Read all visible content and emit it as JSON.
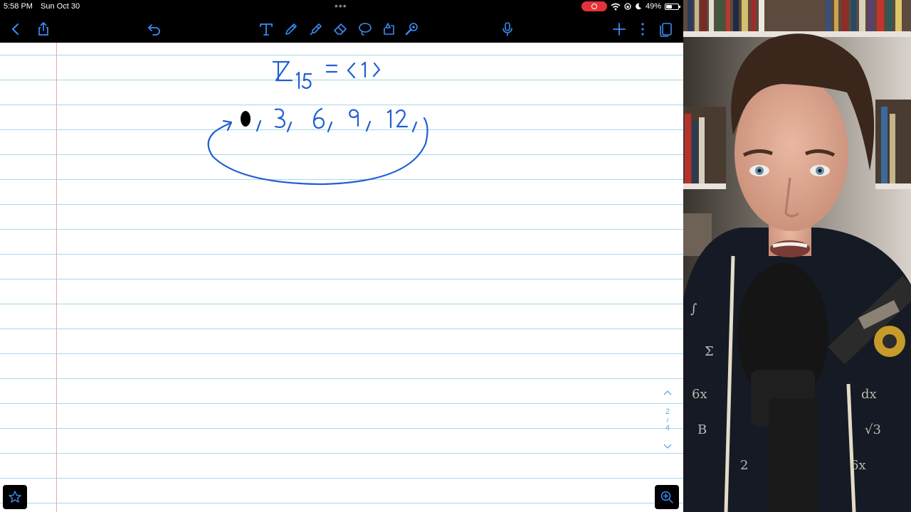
{
  "status_bar": {
    "time": "5:58 PM",
    "date": "Sun Oct 30",
    "battery_percent": "49%",
    "battery_level": 0.49
  },
  "toolbar": {
    "left_icons": [
      "back-icon",
      "share-icon",
      "undo-icon"
    ],
    "tool_icons": [
      "text-tool-icon",
      "pen-icon",
      "highlighter-icon",
      "eraser-icon",
      "lasso-icon",
      "shapes-icon",
      "laser-pointer-icon"
    ],
    "right_icons": [
      "microphone-icon",
      "add-page-icon",
      "more-icon",
      "pages-icon"
    ]
  },
  "page": {
    "background": "lined",
    "ink_color": "#1f5fd4",
    "handwriting": {
      "group_notation": "ℤ₁₅ = ⟨1⟩",
      "cycle_elements": "0, 3, 6, 9, 12,"
    }
  },
  "pager": {
    "current_page": "2",
    "total_pages": "4"
  },
  "colors": {
    "app_chrome": "#000000",
    "toolbar_accent": "#3b8cf5",
    "rule_line": "#a6d8ec",
    "margin_line": "#f2a3b1",
    "recording": "#e5323a"
  },
  "webcam": {
    "content": "presenter-video"
  }
}
